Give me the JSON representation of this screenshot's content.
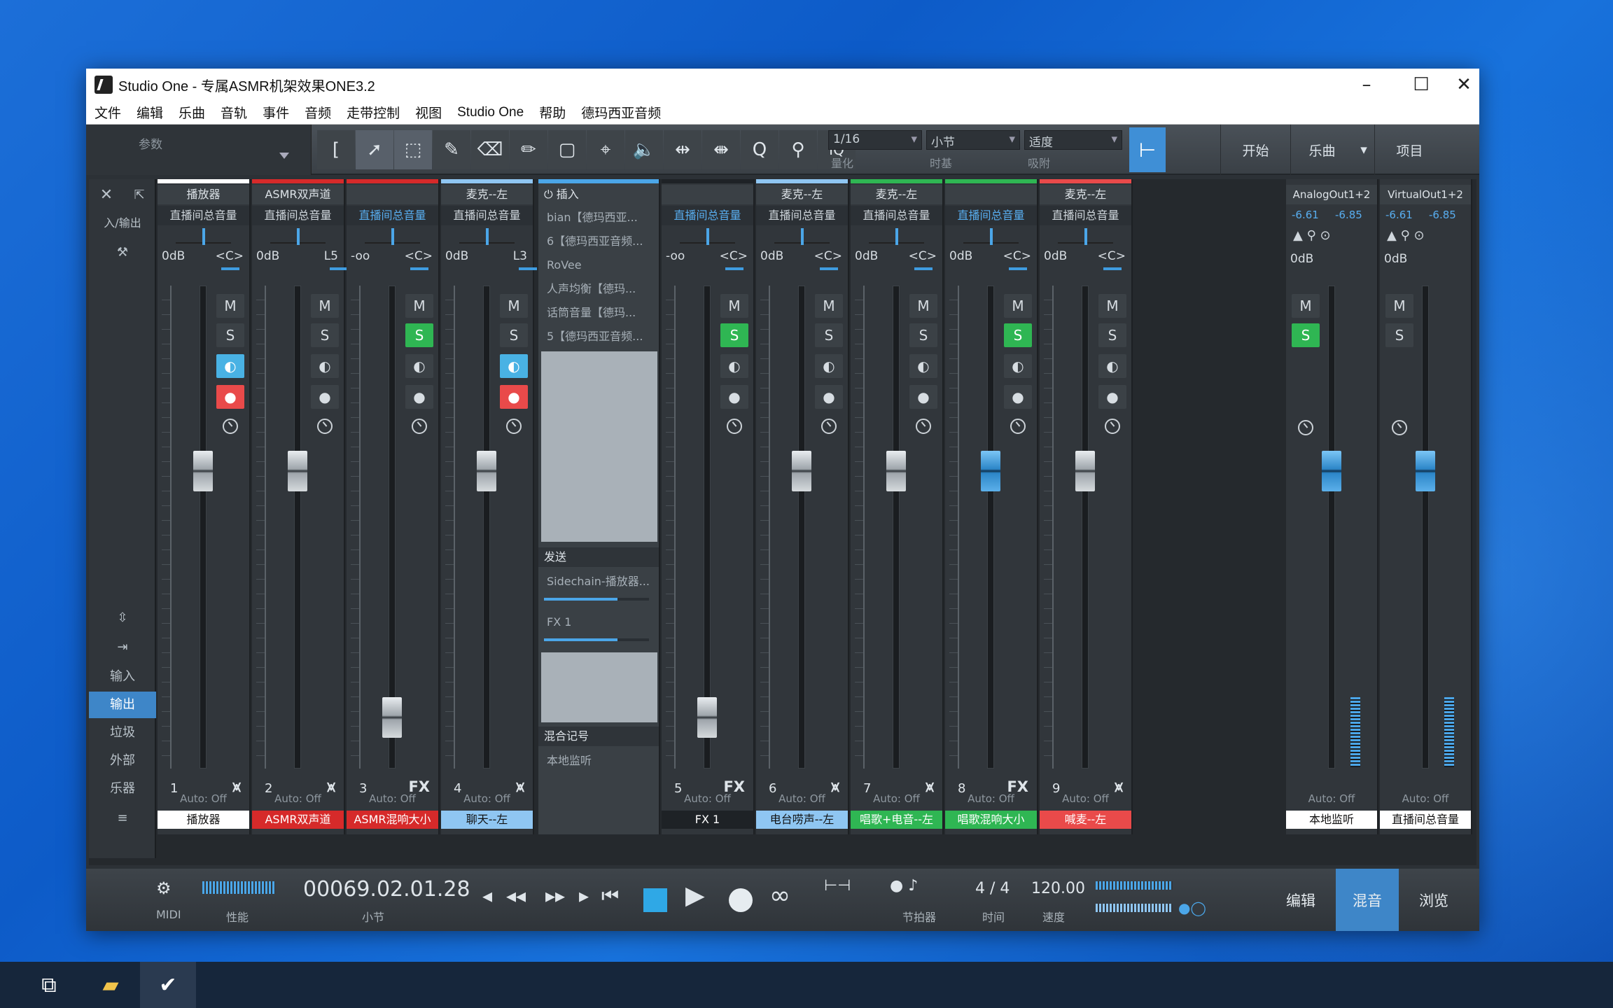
{
  "window": {
    "title": "Studio One - 专属ASMR机架效果ONE3.2"
  },
  "menu": [
    "文件",
    "编辑",
    "乐曲",
    "音轨",
    "事件",
    "音频",
    "走带控制",
    "视图",
    "Studio One",
    "帮助",
    "德玛西亚音频"
  ],
  "toolbar": {
    "param_label": "参数",
    "quantize": "1/16",
    "quantize_label": "量化",
    "timebase": "小节",
    "timebase_label": "时基",
    "snap": "适度",
    "snap_label": "吸附",
    "iq": "IQ",
    "btn_start": "开始",
    "btn_song": "乐曲",
    "btn_project": "项目"
  },
  "sidebar": {
    "io": "入/输出",
    "items": [
      "输入",
      "输出",
      "垃圾",
      "外部",
      "乐器"
    ]
  },
  "channels": [
    {
      "name": "播放器",
      "route": "直播间总音量",
      "vol": "0dB",
      "pan": "<C>",
      "num": "1",
      "auto": "Auto: Off",
      "label": "播放器",
      "color": "#ffffff",
      "text": "#111"
    },
    {
      "name": "ASMR双声道",
      "route": "直播间总音量",
      "vol": "0dB",
      "pan": "L5",
      "num": "2",
      "auto": "Auto: Off",
      "label": "ASMR双声道",
      "color": "#d62a2a",
      "text": "#fff"
    },
    {
      "name": "",
      "route": "直播间总音量",
      "vol": "-oo",
      "pan": "<C>",
      "num": "3",
      "auto": "Auto: Off",
      "label": "ASMR混响大小",
      "color": "#d62a2a",
      "text": "#fff",
      "fx": "FX"
    },
    {
      "name": "麦克--左",
      "route": "直播间总音量",
      "vol": "0dB",
      "pan": "L3",
      "num": "4",
      "auto": "Auto: Off",
      "label": "聊天--左",
      "color": "#8fc6f2",
      "text": "#111"
    },
    {
      "name": "",
      "route": "直播间总音量",
      "vol": "-oo",
      "pan": "<C>",
      "num": "5",
      "auto": "Auto: Off",
      "label": "FX 1",
      "color": "#1e2226",
      "text": "#fff",
      "fx": "FX"
    },
    {
      "name": "麦克--左",
      "route": "直播间总音量",
      "vol": "0dB",
      "pan": "<C>",
      "num": "6",
      "auto": "Auto: Off",
      "label": "电台唠声--左",
      "color": "#8fc6f2",
      "text": "#111"
    },
    {
      "name": "麦克--左",
      "route": "直播间总音量",
      "vol": "0dB",
      "pan": "<C>",
      "num": "7",
      "auto": "Auto: Off",
      "label": "唱歌+电音--左",
      "color": "#2fb653",
      "text": "#fff"
    },
    {
      "name": "",
      "route": "直播间总音量",
      "vol": "0dB",
      "pan": "<C>",
      "num": "8",
      "auto": "Auto: Off",
      "label": "唱歌混响大小",
      "color": "#2fb653",
      "text": "#fff",
      "fx": "FX"
    },
    {
      "name": "麦克--左",
      "route": "直播间总音量",
      "vol": "0dB",
      "pan": "<C>",
      "num": "9",
      "auto": "Auto: Off",
      "label": "喊麦--左",
      "color": "#e94a4a",
      "text": "#fff"
    }
  ],
  "inserts": {
    "header": "插入",
    "items": [
      "bian【德玛西亚...",
      "6【德玛西亚音频...",
      "RoVee",
      "人声均衡【德玛...",
      "话筒音量【德玛...",
      "5【德玛西亚音频..."
    ],
    "send_header": "发送",
    "sends": [
      "Sidechain-播放器...",
      "FX 1"
    ],
    "mix_header": "混合记号",
    "mix_item": "本地监听"
  },
  "outputs": [
    {
      "name": "AnalogOut1+2",
      "db1": "-6.61",
      "db2": "-6.85",
      "vol": "0dB",
      "auto": "Auto: Off",
      "label": "本地监听"
    },
    {
      "name": "VirtualOut1+2",
      "db1": "-6.61",
      "db2": "-6.85",
      "vol": "0dB",
      "auto": "Auto: Off",
      "label": "直播间总音量"
    }
  ],
  "transport": {
    "midi": "MIDI",
    "perf": "性能",
    "time": "00069.02.01.28",
    "time_label": "小节",
    "sig": "4 / 4",
    "sig_label": "时间",
    "tempo": "120.00",
    "tempo_label": "速度",
    "metro_label": "节拍器",
    "edit": "编辑",
    "mix": "混音",
    "browse": "浏览"
  }
}
